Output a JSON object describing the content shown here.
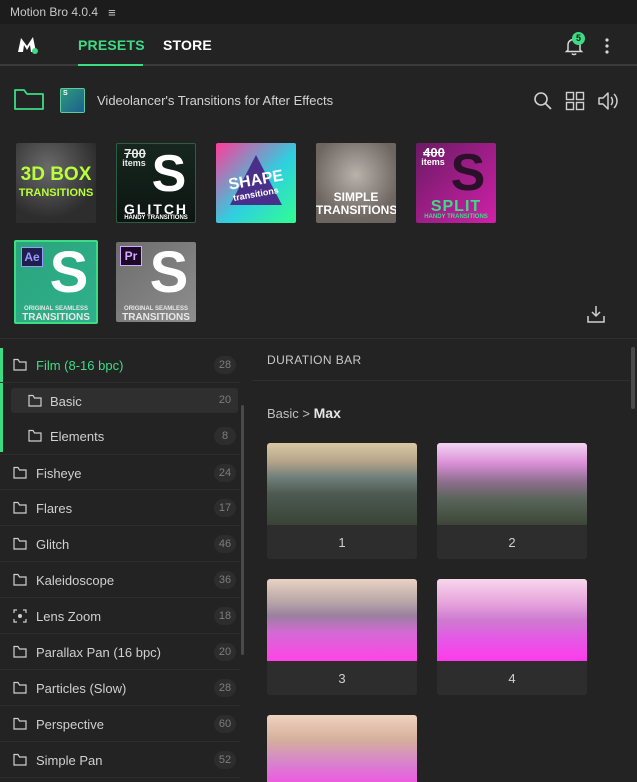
{
  "app": {
    "title": "Motion Bro 4.0.4",
    "menu_glyph": "≡"
  },
  "header": {
    "tabs": [
      {
        "label": "PRESETS"
      },
      {
        "label": "STORE"
      }
    ],
    "notifications_count": "5"
  },
  "library": {
    "title": "Videolancer's Transitions for After Effects",
    "packs": [
      {
        "line1": "3D BOX",
        "line2": "TRANSITIONS"
      },
      {
        "count": "700",
        "unit": "items",
        "big": "S",
        "line1": "GLITCH",
        "line2": "HANDY TRANSITIONS"
      },
      {
        "line1": "SHAPE",
        "line2": "transitions"
      },
      {
        "line1": "SIMPLE",
        "line2": "TRANSITIONS"
      },
      {
        "count": "400",
        "unit": "items",
        "big": "S",
        "line1": "SPLIT",
        "line2": "HANDY TRANSITIONS"
      },
      {
        "app": "Ae",
        "big": "S",
        "line1": "ORIGINAL SEAMLESS",
        "line2": "TRANSITIONS"
      },
      {
        "app": "Pr",
        "big": "S",
        "line1": "ORIGINAL SEAMLESS",
        "line2": "TRANSITIONS"
      }
    ]
  },
  "sidebar": {
    "items": [
      {
        "label": "Film (8-16 bpc)",
        "count": "28"
      },
      {
        "label": "Basic",
        "count": "20"
      },
      {
        "label": "Elements",
        "count": "8"
      },
      {
        "label": "Fisheye",
        "count": "24"
      },
      {
        "label": "Flares",
        "count": "17"
      },
      {
        "label": "Glitch",
        "count": "46"
      },
      {
        "label": "Kaleidoscope",
        "count": "36"
      },
      {
        "label": "Lens Zoom",
        "count": "18"
      },
      {
        "label": "Parallax Pan (16 bpc)",
        "count": "20"
      },
      {
        "label": "Particles (Slow)",
        "count": "28"
      },
      {
        "label": "Perspective",
        "count": "60"
      },
      {
        "label": "Simple Pan",
        "count": "52"
      }
    ]
  },
  "content": {
    "section_title": "DURATION BAR",
    "breadcrumb_parent": "Basic",
    "breadcrumb_sep": ">",
    "breadcrumb_current": "Max",
    "presets": [
      {
        "label": "1"
      },
      {
        "label": "2"
      },
      {
        "label": "3"
      },
      {
        "label": "4"
      },
      {
        "label": ""
      }
    ]
  },
  "colors": {
    "accent": "#3ddc84",
    "background": "#232323"
  }
}
